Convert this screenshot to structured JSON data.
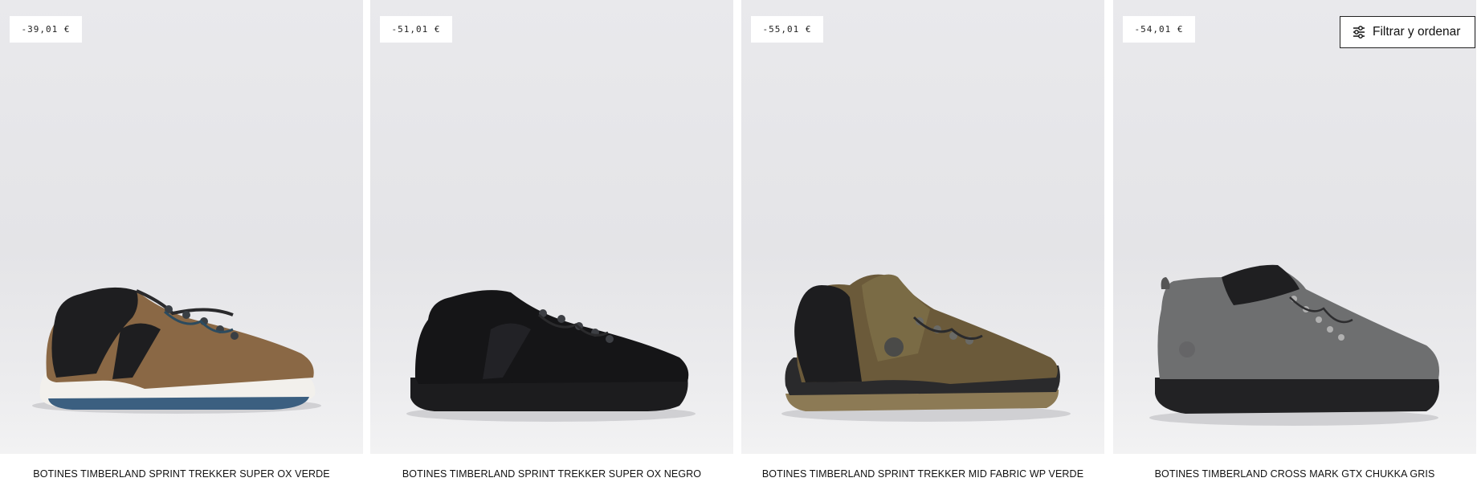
{
  "toolbar": {
    "filter_label": "Filtrar y ordenar",
    "filter_icon": "sliders-icon"
  },
  "products": [
    {
      "badge": "-39,01 €",
      "title": "BOTINES TIMBERLAND SPRINT TREKKER SUPER OX VERDE"
    },
    {
      "badge": "-51,01 €",
      "title": "BOTINES TIMBERLAND SPRINT TREKKER SUPER OX NEGRO"
    },
    {
      "badge": "-55,01 €",
      "title": "BOTINES TIMBERLAND SPRINT TREKKER MID FABRIC WP VERDE"
    },
    {
      "badge": "-54,01 €",
      "title": "BOTINES TIMBERLAND CROSS MARK GTX CHUKKA GRIS"
    }
  ],
  "colors": {
    "background": "#ffffff",
    "image_bg": "#e6e6e9",
    "text": "#111111"
  }
}
